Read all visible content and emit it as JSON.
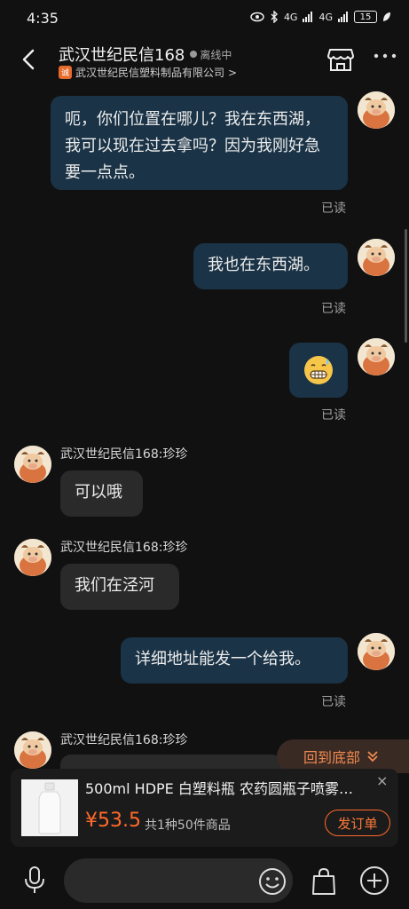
{
  "status_bar": {
    "time": "4:35",
    "network_a": "4G",
    "network_b": "4G",
    "battery": "15"
  },
  "header": {
    "shop_name": "武汉世纪民信168",
    "status": "离线中",
    "company_badge": "诚",
    "company": "武汉世纪民信塑料制品有限公司",
    "company_arrow": ">"
  },
  "messages": [
    {
      "dir": "out",
      "text": "呃，你们位置在哪儿？我在东西湖，我可以现在过去拿吗？因为我刚好急要一点点。",
      "read": "已读"
    },
    {
      "dir": "out",
      "text": "我也在东西湖。",
      "read": "已读"
    },
    {
      "dir": "out",
      "type": "emoji",
      "emoji": "grimacing-sweat-emoji",
      "read": "已读"
    },
    {
      "dir": "in",
      "sender": "武汉世纪民信168:珍珍",
      "text": "可以哦"
    },
    {
      "dir": "in",
      "sender": "武汉世纪民信168:珍珍",
      "text": "我们在泾河"
    },
    {
      "dir": "out",
      "text": "详细地址能发一个给我。",
      "read": "已读"
    },
    {
      "dir": "in",
      "sender": "武汉世纪民信168:珍珍",
      "text": ""
    }
  ],
  "back_to_bottom": {
    "label": "回到底部"
  },
  "product": {
    "title": "500ml HDPE 白塑料瓶 农药圆瓶子喷雾…",
    "price": "¥53.5",
    "summary": "共1种50件商品",
    "order_label": "发订单",
    "close": "×"
  },
  "input_bar": {
    "placeholder": ""
  },
  "colors": {
    "accent": "#ff6a2a",
    "outgoing_bubble": "#1a3346",
    "incoming_bubble": "#2a2a2a",
    "background": "#111111"
  }
}
